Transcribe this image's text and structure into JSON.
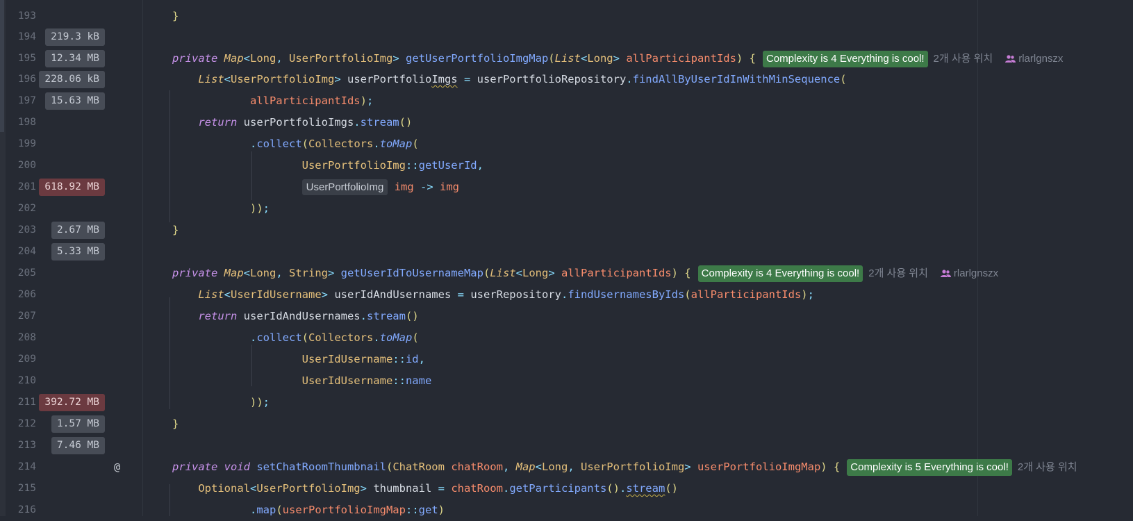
{
  "lines": [
    {
      "num": "193",
      "mem": ""
    },
    {
      "num": "194",
      "mem": "219.3 kB"
    },
    {
      "num": "195",
      "mem": "12.34 MB"
    },
    {
      "num": "196",
      "mem": "228.06 kB"
    },
    {
      "num": "197",
      "mem": "15.63 MB"
    },
    {
      "num": "198",
      "mem": ""
    },
    {
      "num": "199",
      "mem": ""
    },
    {
      "num": "200",
      "mem": ""
    },
    {
      "num": "201",
      "mem": "618.92 MB"
    },
    {
      "num": "202",
      "mem": ""
    },
    {
      "num": "203",
      "mem": "2.67 MB"
    },
    {
      "num": "204",
      "mem": "5.33 MB"
    },
    {
      "num": "205",
      "mem": ""
    },
    {
      "num": "206",
      "mem": ""
    },
    {
      "num": "207",
      "mem": ""
    },
    {
      "num": "208",
      "mem": ""
    },
    {
      "num": "209",
      "mem": ""
    },
    {
      "num": "210",
      "mem": ""
    },
    {
      "num": "211",
      "mem": "392.72 MB"
    },
    {
      "num": "212",
      "mem": "1.57 MB"
    },
    {
      "num": "213",
      "mem": "7.46 MB"
    },
    {
      "num": "214",
      "mem": ""
    },
    {
      "num": "215",
      "mem": ""
    },
    {
      "num": "216",
      "mem": ""
    }
  ],
  "gutter": {
    "at_symbol": "@"
  },
  "inlay": {
    "complexity_195": "Complexity is 4 Everything is cool!",
    "usages_195": "2개 사용 위치",
    "author_195": "rlarlgnszx",
    "complexity_205": "Complexity is 4 Everything is cool!",
    "usages_205": "2개 사용 위치",
    "author_205": "rlarlgnszx",
    "complexity_214": "Complexity is 5 Everything is cool!",
    "usages_214": "2개 사용 위치",
    "param_hint_201": "UserPortfolioImg"
  },
  "colors": {
    "background": "#262a33",
    "complexity_badge": "#3d7a48",
    "hot_memory": "#6b3a40"
  }
}
